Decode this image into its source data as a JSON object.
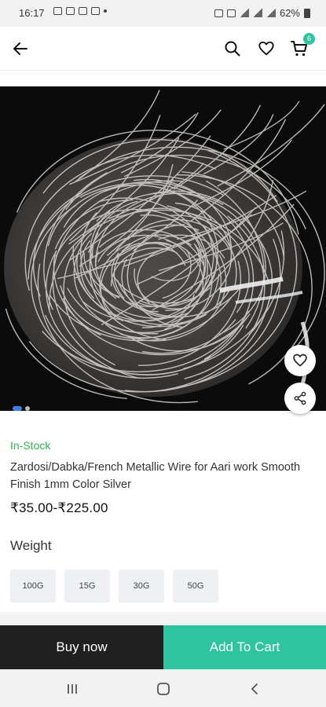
{
  "status_bar": {
    "time": "16:17",
    "battery": "62%",
    "left_icons": [
      "image-icon",
      "gallery-icon",
      "mail-icon",
      "message-icon",
      "dot-icon"
    ],
    "right_icons": [
      "alarm-icon",
      "bluetooth-icon",
      "wifi-icon",
      "signal-icon",
      "signal-icon",
      "battery-icon"
    ]
  },
  "header": {
    "back_icon": "arrow-left-icon",
    "search_icon": "search-icon",
    "wishlist_icon": "heart-icon",
    "cart_icon": "cart-icon",
    "cart_count": "6"
  },
  "product": {
    "image_description_icon": "product-photo",
    "stock_status": "In-Stock",
    "title": "Zardosi/Dabka/French Metallic Wire for Aari work Smooth Finish 1mm Color Silver",
    "price": "₹35.00-₹225.00",
    "weight_label": "Weight",
    "weight_options": [
      "100G",
      "15G",
      "30G",
      "50G"
    ],
    "image_count": 2,
    "active_image": 1
  },
  "actions": {
    "buy_now": "Buy now",
    "add_to_cart": "Add To Cart"
  },
  "colors": {
    "accent": "#2ec4a0",
    "stock_green": "#2fb84d",
    "buy_now_bg": "#202020",
    "pager_active": "#3f7ee8"
  }
}
